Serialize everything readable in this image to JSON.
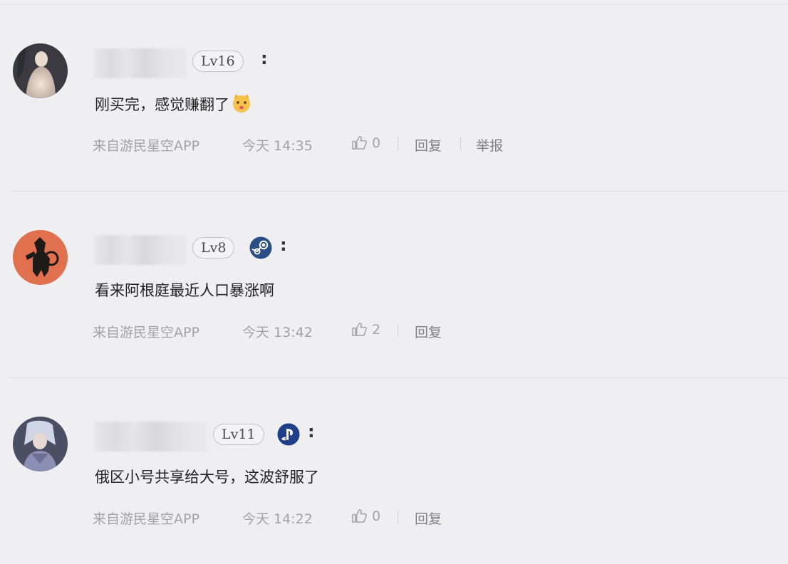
{
  "comments": [
    {
      "level": "Lv16",
      "platform_icon": "none",
      "colon": ":",
      "text": "刚买完，感觉赚翻了",
      "emoji": "cat-face-emoji",
      "source": "来自游民星空APP",
      "time": "今天 14:35",
      "likes": "0",
      "reply_label": "回复",
      "report_label": "举报"
    },
    {
      "level": "Lv8",
      "platform_icon": "steam-icon",
      "colon": ":",
      "text": "看来阿根庭最近人口暴涨啊",
      "source": "来自游民星空APP",
      "time": "今天 13:42",
      "likes": "2",
      "reply_label": "回复"
    },
    {
      "level": "Lv11",
      "platform_icon": "playstation-icon",
      "colon": ":",
      "text": "俄区小号共享给大号，这波舒服了",
      "source": "来自游民星空APP",
      "time": "今天 14:22",
      "likes": "0",
      "reply_label": "回复"
    }
  ],
  "colors": {
    "background": "#efeff1",
    "meta_text": "#a3a3a7",
    "steam_blue": "#2a4f86",
    "psn_blue": "#1f3f8a"
  }
}
